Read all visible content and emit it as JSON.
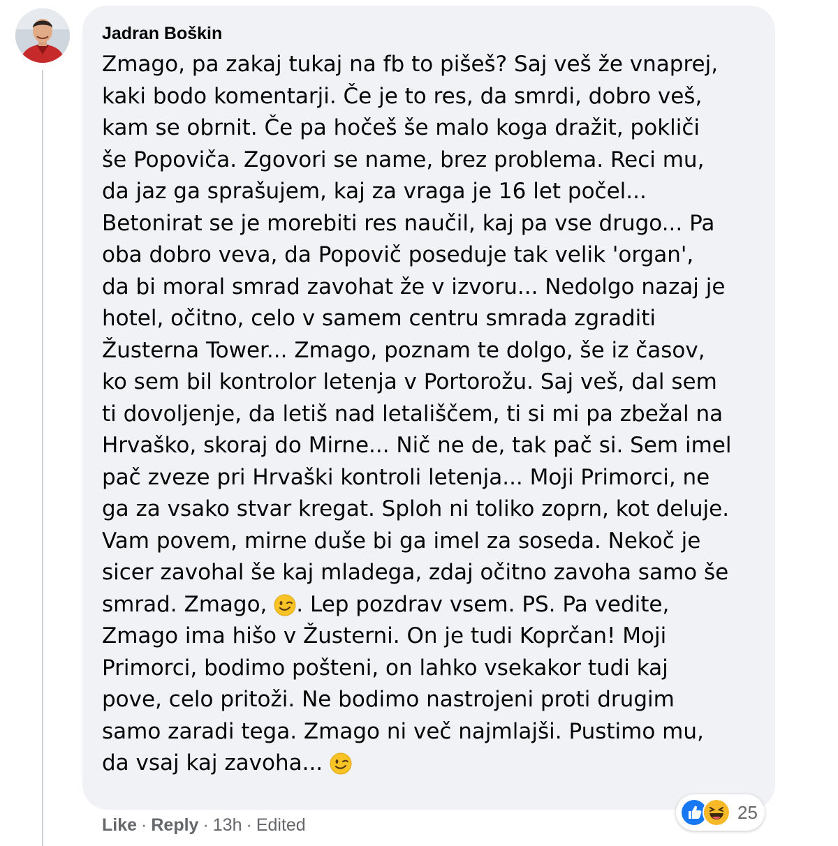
{
  "comment": {
    "author": "Jadran Boškin",
    "avatar_icon": "profile-photo-avatar",
    "lines": [
      "Zmago, pa zakaj tukaj na fb to pišeš? Saj veš že vnaprej,",
      "kaki bodo komentarji. Če je to res, da smrdi, dobro veš,",
      "kam se obrnit. Če pa hočeš še malo koga dražit, pokliči",
      "še Popoviča. Zgovori se name, brez problema. Reci mu,",
      "da jaz ga sprašujem, kaj za vraga je 16 let počel...",
      "Betonirat se je morebiti res naučil, kaj pa vse drugo... Pa",
      "oba dobro veva, da Popovič poseduje tak velik 'organ',",
      "da bi moral smrad zavohat že v izvoru... Nedolgo nazaj je",
      "hotel, očitno, celo v samem centru smrada zgraditi",
      "Žusterna Tower... Zmago, poznam te dolgo, še iz časov,",
      "ko sem bil kontrolor letenja v Portorožu. Saj veš, dal sem",
      "ti dovoljenje, da letiš nad letališčem, ti si mi pa zbežal na",
      "Hrvaško, skoraj do Mirne... Nič ne de, tak pač si. Sem imel",
      "pač zveze pri Hrvaški kontroli letenja... Moji Primorci, ne",
      "ga za vsako stvar kregat. Sploh ni toliko zoprn, kot deluje.",
      "Vam povem, mirne duše bi ga imel za soseda. Nekoč je",
      "sicer zavohal še kaj mladega, zdaj očitno zavoha samo še"
    ],
    "line18_before": "smrad. Zmago, ",
    "line18_after": ". Lep pozdrav vsem. PS. Pa vedite,",
    "lines_b": [
      "Zmago ima hišo v Žusterni. On je tudi Koprčan! Moji",
      "Primorci, bodimo pošteni, on lahko vsekakor tudi kaj",
      "pove, celo pritoži. Ne bodimo nastrojeni proti drugim",
      "samo zaradi tega. Zmago ni več najmlajši. Pustimo mu,"
    ],
    "last_line": "da vsaj kaj zavoha... ",
    "emoji_icon": "winking-face-emoji"
  },
  "reactions": {
    "icons": [
      "like-reaction-icon",
      "haha-reaction-icon"
    ],
    "count": "25"
  },
  "actions": {
    "like": "Like",
    "dot1": "·",
    "reply": "Reply",
    "dot2": "·",
    "time": "13h",
    "dot3": "·",
    "edited": "Edited"
  },
  "colors": {
    "bubble_bg": "#f0f2f5",
    "text": "#050505",
    "secondary_text": "#65676b",
    "like_blue": "#1877f2",
    "haha_yellow": "#f7b928"
  }
}
